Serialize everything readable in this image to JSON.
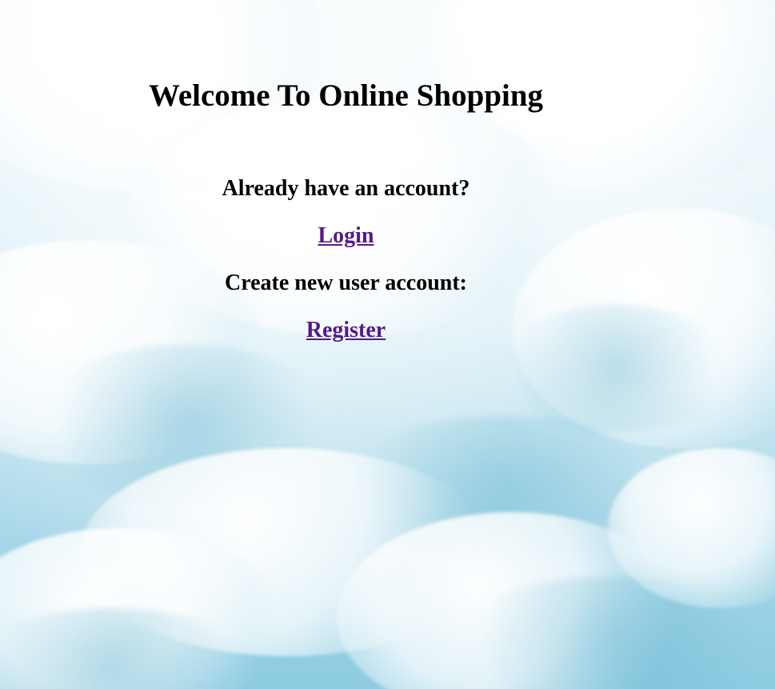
{
  "page": {
    "title": "Welcome To Online Shopping",
    "login_prompt": "Already have an account?",
    "login_link": "Login",
    "register_prompt": "Create new user account:",
    "register_link": "Register"
  },
  "colors": {
    "link_visited": "#551a8b",
    "text": "#000000",
    "sky_light": "#eaf6fb",
    "sky_dark": "#8ccbe1"
  },
  "background": {
    "description_icon": "cloud-sky-background"
  }
}
